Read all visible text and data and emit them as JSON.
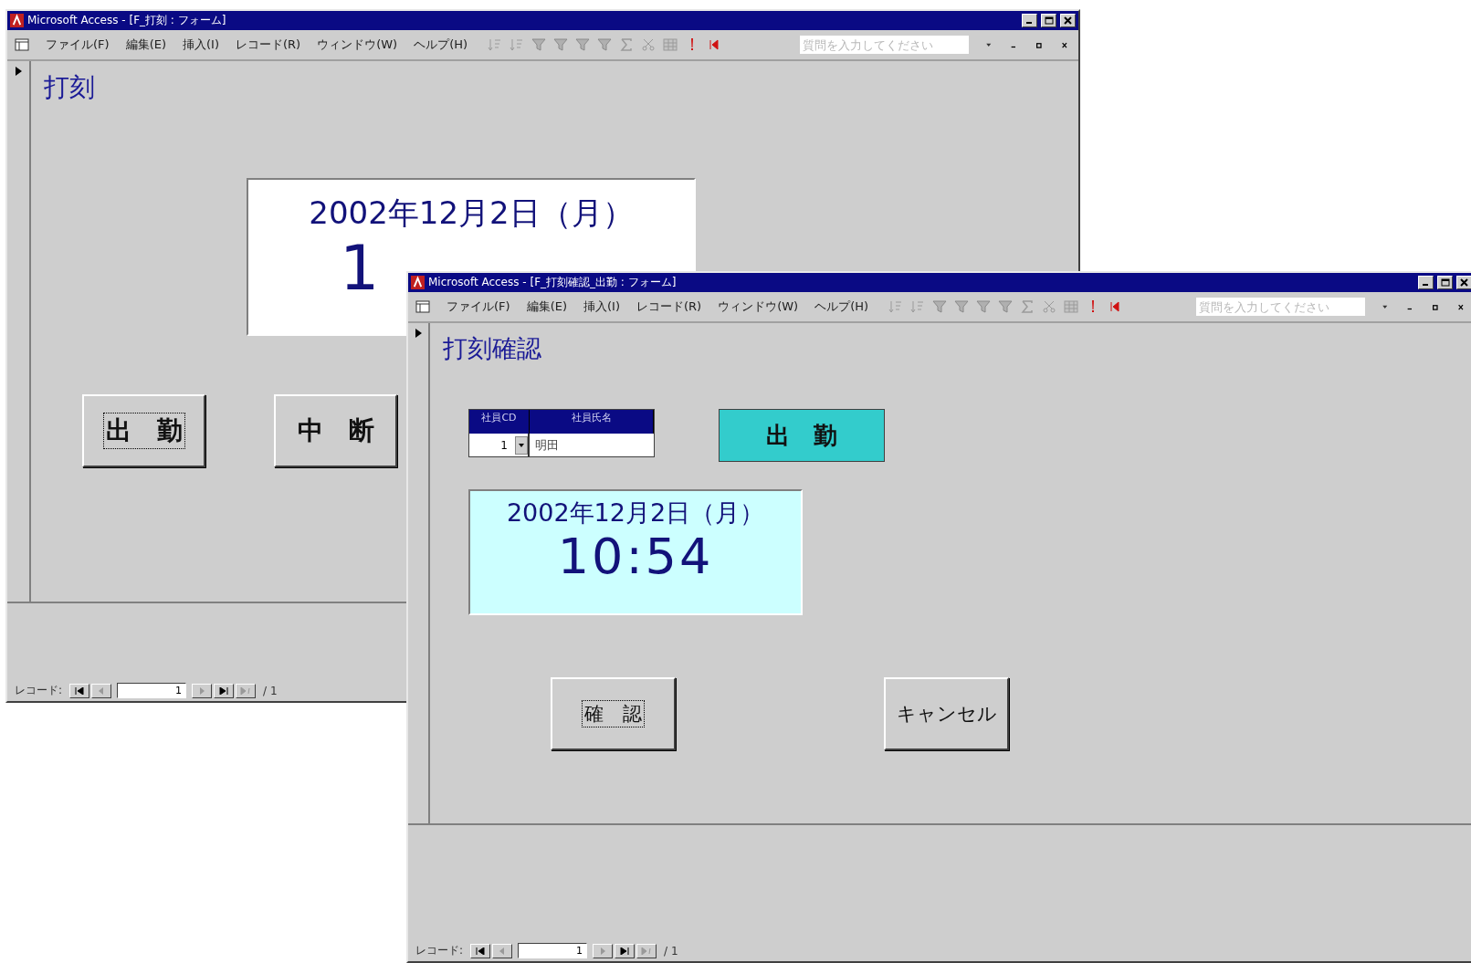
{
  "back_window": {
    "title": "Microsoft Access - [F_打刻 : フォーム]",
    "menu": [
      "ファイル(F)",
      "編集(E)",
      "挿入(I)",
      "レコード(R)",
      "ウィンドウ(W)",
      "ヘルプ(H)"
    ],
    "help_search": {
      "placeholder": "質問を入力してください"
    },
    "form": {
      "heading": "打刻",
      "clock": {
        "date": "2002年12月2日（月）",
        "time": "1"
      },
      "buttons": [
        {
          "label": "出　勤",
          "focused": true
        },
        {
          "label": "中　断",
          "focused": false
        }
      ]
    },
    "navigator": {
      "label": "レコード:",
      "current": "1",
      "total": "/ 1"
    }
  },
  "front_window": {
    "title": "Microsoft Access - [F_打刻確認_出勤 : フォーム]",
    "menu": [
      "ファイル(F)",
      "編集(E)",
      "挿入(I)",
      "レコード(R)",
      "ウィンドウ(W)",
      "ヘルプ(H)"
    ],
    "help_search": {
      "placeholder": "質問を入力してください"
    },
    "form": {
      "heading": "打刻確認",
      "employee": {
        "columns": [
          "社員CD",
          "社員氏名"
        ],
        "code": "1",
        "name": "明田"
      },
      "status_label": "出　勤",
      "clock": {
        "date": "2002年12月2日（月）",
        "time": "10:54"
      },
      "buttons": [
        {
          "label": "確　認",
          "focused": true
        },
        {
          "label": "キャンセル",
          "focused": false
        }
      ]
    },
    "navigator": {
      "label": "レコード:",
      "current": "1",
      "total": "/ 1"
    }
  }
}
